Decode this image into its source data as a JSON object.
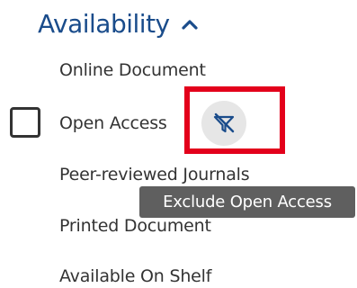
{
  "facet": {
    "title": "Availability",
    "expand_icon": "chevron-up-icon",
    "options": [
      {
        "label": "Online Document"
      },
      {
        "label": "Open Access",
        "checked": false
      },
      {
        "label": "Peer-reviewed Journals"
      },
      {
        "label": "Printed Document"
      },
      {
        "label": "Available On Shelf"
      }
    ],
    "exclude_icon": "exclude-filter-icon",
    "tooltip": "Exclude Open Access"
  },
  "colors": {
    "title": "#1a4c8b",
    "text": "#333333",
    "highlight": "#e3001b",
    "tooltip_bg": "#5f5f5f",
    "icon": "#1a4c8b"
  }
}
